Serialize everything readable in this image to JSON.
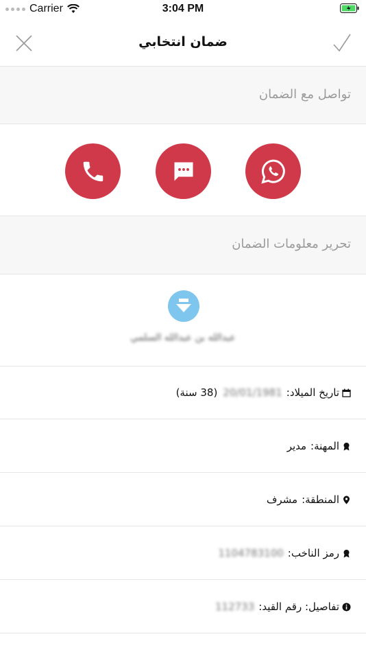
{
  "status_bar": {
    "carrier": "Carrier",
    "time": "3:04 PM"
  },
  "nav": {
    "title": "ضمان انتخابي",
    "close_icon": "close-icon",
    "done_icon": "checkmark-icon"
  },
  "sections": {
    "contact": "تواصل مع الضمان",
    "edit": "تحرير معلومات الضمان"
  },
  "contact_buttons": {
    "color": "#d0394a",
    "phone": "phone-icon",
    "sms": "message-icon",
    "whatsapp": "whatsapp-icon"
  },
  "profile": {
    "avatar_color": "#7fc6ee",
    "name": "عبدالله بن عبدالله السلمي"
  },
  "info": {
    "birth_label": "تاريخ الميلاد:",
    "birth_value": "20/01/1981",
    "birth_age": "(38 سنة)",
    "job_label": "المهنة:",
    "job_value": "مدير",
    "region_label": "المنطقة:",
    "region_value": "مشرف",
    "voter_label": "رمز الناخب:",
    "voter_value": "1104783100",
    "details_label": "تفاصيل: رقم القيد:",
    "details_value": "112733"
  }
}
